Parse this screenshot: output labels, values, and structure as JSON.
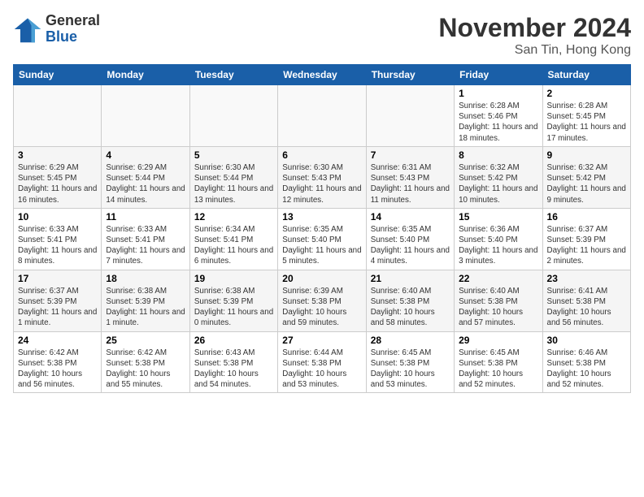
{
  "header": {
    "logo_general": "General",
    "logo_blue": "Blue",
    "month_title": "November 2024",
    "location": "San Tin, Hong Kong"
  },
  "weekdays": [
    "Sunday",
    "Monday",
    "Tuesday",
    "Wednesday",
    "Thursday",
    "Friday",
    "Saturday"
  ],
  "weeks": [
    [
      {
        "day": "",
        "info": ""
      },
      {
        "day": "",
        "info": ""
      },
      {
        "day": "",
        "info": ""
      },
      {
        "day": "",
        "info": ""
      },
      {
        "day": "",
        "info": ""
      },
      {
        "day": "1",
        "info": "Sunrise: 6:28 AM\nSunset: 5:46 PM\nDaylight: 11 hours and 18 minutes."
      },
      {
        "day": "2",
        "info": "Sunrise: 6:28 AM\nSunset: 5:45 PM\nDaylight: 11 hours and 17 minutes."
      }
    ],
    [
      {
        "day": "3",
        "info": "Sunrise: 6:29 AM\nSunset: 5:45 PM\nDaylight: 11 hours and 16 minutes."
      },
      {
        "day": "4",
        "info": "Sunrise: 6:29 AM\nSunset: 5:44 PM\nDaylight: 11 hours and 14 minutes."
      },
      {
        "day": "5",
        "info": "Sunrise: 6:30 AM\nSunset: 5:44 PM\nDaylight: 11 hours and 13 minutes."
      },
      {
        "day": "6",
        "info": "Sunrise: 6:30 AM\nSunset: 5:43 PM\nDaylight: 11 hours and 12 minutes."
      },
      {
        "day": "7",
        "info": "Sunrise: 6:31 AM\nSunset: 5:43 PM\nDaylight: 11 hours and 11 minutes."
      },
      {
        "day": "8",
        "info": "Sunrise: 6:32 AM\nSunset: 5:42 PM\nDaylight: 11 hours and 10 minutes."
      },
      {
        "day": "9",
        "info": "Sunrise: 6:32 AM\nSunset: 5:42 PM\nDaylight: 11 hours and 9 minutes."
      }
    ],
    [
      {
        "day": "10",
        "info": "Sunrise: 6:33 AM\nSunset: 5:41 PM\nDaylight: 11 hours and 8 minutes."
      },
      {
        "day": "11",
        "info": "Sunrise: 6:33 AM\nSunset: 5:41 PM\nDaylight: 11 hours and 7 minutes."
      },
      {
        "day": "12",
        "info": "Sunrise: 6:34 AM\nSunset: 5:41 PM\nDaylight: 11 hours and 6 minutes."
      },
      {
        "day": "13",
        "info": "Sunrise: 6:35 AM\nSunset: 5:40 PM\nDaylight: 11 hours and 5 minutes."
      },
      {
        "day": "14",
        "info": "Sunrise: 6:35 AM\nSunset: 5:40 PM\nDaylight: 11 hours and 4 minutes."
      },
      {
        "day": "15",
        "info": "Sunrise: 6:36 AM\nSunset: 5:40 PM\nDaylight: 11 hours and 3 minutes."
      },
      {
        "day": "16",
        "info": "Sunrise: 6:37 AM\nSunset: 5:39 PM\nDaylight: 11 hours and 2 minutes."
      }
    ],
    [
      {
        "day": "17",
        "info": "Sunrise: 6:37 AM\nSunset: 5:39 PM\nDaylight: 11 hours and 1 minute."
      },
      {
        "day": "18",
        "info": "Sunrise: 6:38 AM\nSunset: 5:39 PM\nDaylight: 11 hours and 1 minute."
      },
      {
        "day": "19",
        "info": "Sunrise: 6:38 AM\nSunset: 5:39 PM\nDaylight: 11 hours and 0 minutes."
      },
      {
        "day": "20",
        "info": "Sunrise: 6:39 AM\nSunset: 5:38 PM\nDaylight: 10 hours and 59 minutes."
      },
      {
        "day": "21",
        "info": "Sunrise: 6:40 AM\nSunset: 5:38 PM\nDaylight: 10 hours and 58 minutes."
      },
      {
        "day": "22",
        "info": "Sunrise: 6:40 AM\nSunset: 5:38 PM\nDaylight: 10 hours and 57 minutes."
      },
      {
        "day": "23",
        "info": "Sunrise: 6:41 AM\nSunset: 5:38 PM\nDaylight: 10 hours and 56 minutes."
      }
    ],
    [
      {
        "day": "24",
        "info": "Sunrise: 6:42 AM\nSunset: 5:38 PM\nDaylight: 10 hours and 56 minutes."
      },
      {
        "day": "25",
        "info": "Sunrise: 6:42 AM\nSunset: 5:38 PM\nDaylight: 10 hours and 55 minutes."
      },
      {
        "day": "26",
        "info": "Sunrise: 6:43 AM\nSunset: 5:38 PM\nDaylight: 10 hours and 54 minutes."
      },
      {
        "day": "27",
        "info": "Sunrise: 6:44 AM\nSunset: 5:38 PM\nDaylight: 10 hours and 53 minutes."
      },
      {
        "day": "28",
        "info": "Sunrise: 6:45 AM\nSunset: 5:38 PM\nDaylight: 10 hours and 53 minutes."
      },
      {
        "day": "29",
        "info": "Sunrise: 6:45 AM\nSunset: 5:38 PM\nDaylight: 10 hours and 52 minutes."
      },
      {
        "day": "30",
        "info": "Sunrise: 6:46 AM\nSunset: 5:38 PM\nDaylight: 10 hours and 52 minutes."
      }
    ]
  ]
}
